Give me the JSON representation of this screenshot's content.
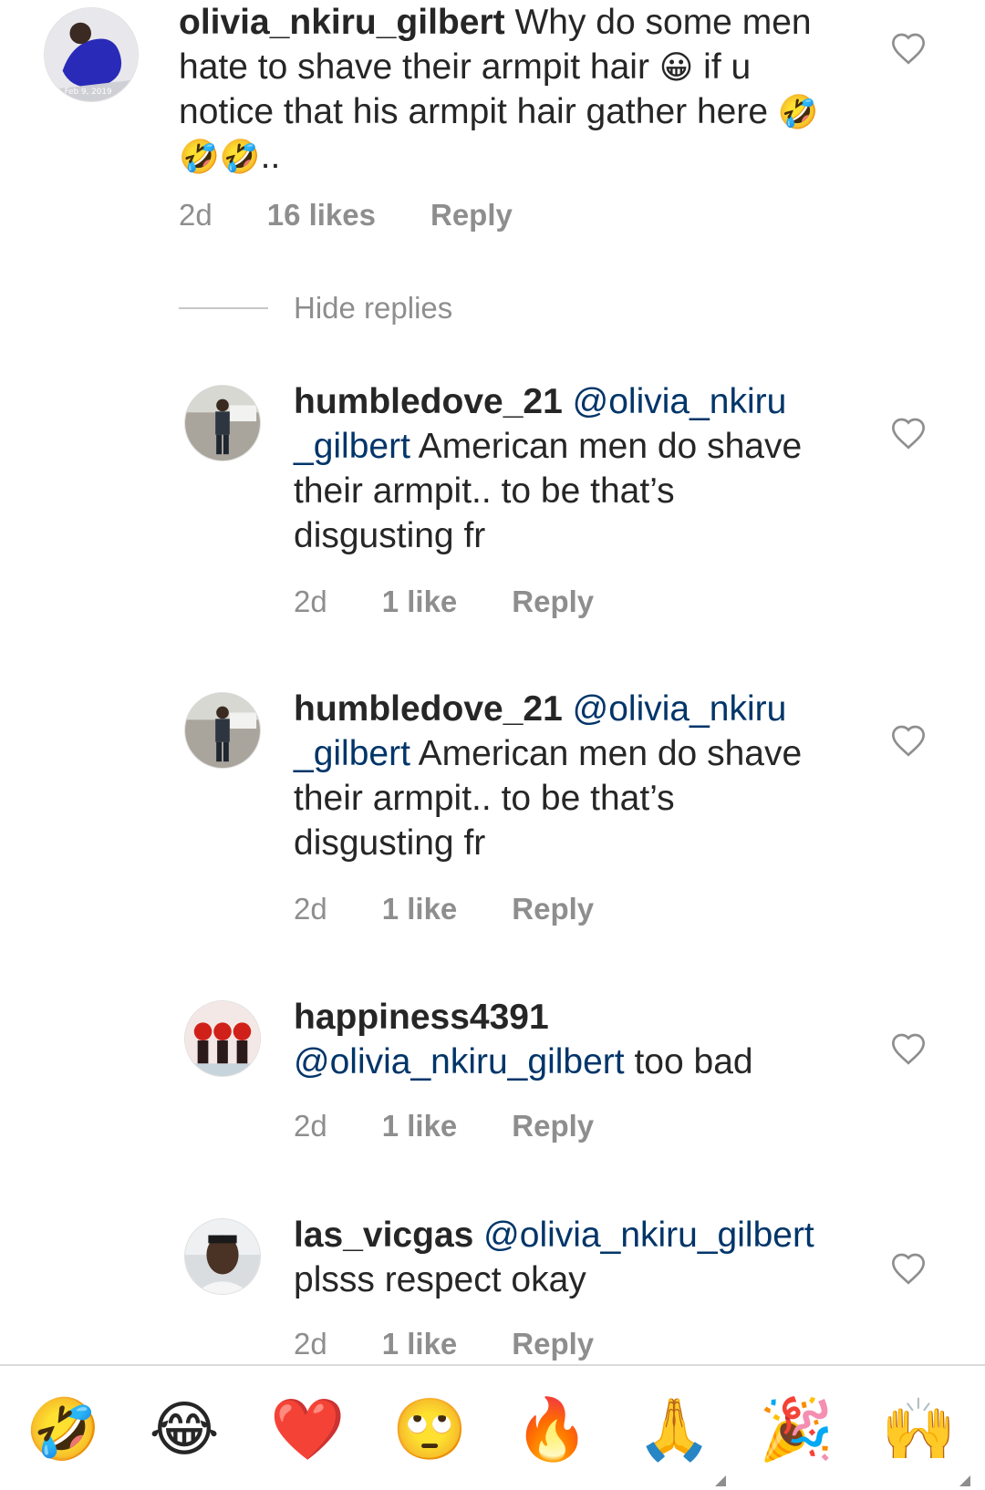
{
  "comments": [
    {
      "username": "olivia_nkiru_gilbert",
      "mention": "",
      "text": "Why do some men hate to shave their armpit hair",
      "emoji1": "😀",
      "text2": "if u notice that his armpit hair gather here",
      "emoji2": "🤣🤣🤣",
      "text3": "..",
      "avatar_caption": "Feb 9, 2019",
      "time": "2d",
      "likes": "16 likes",
      "reply": "Reply"
    },
    {
      "username": "humbledove_21",
      "mention": "@olivia_nkiru _gilbert",
      "text": "American men do shave their armpit.. to be that’s disgusting fr",
      "time": "2d",
      "likes": "1 like",
      "reply": "Reply"
    },
    {
      "username": "humbledove_21",
      "mention": "@olivia_nkiru _gilbert",
      "text": "American men do shave their armpit.. to be that’s disgusting fr",
      "time": "2d",
      "likes": "1 like",
      "reply": "Reply"
    },
    {
      "username": "happiness4391",
      "mention": "@olivia_nkiru_gilbert",
      "text": "too bad",
      "time": "2d",
      "likes": "1 like",
      "reply": "Reply"
    },
    {
      "username": "las_vicgas",
      "mention": "@olivia_nkiru_gilbert",
      "text": "plsss respect okay",
      "time": "2d",
      "likes": "1 like",
      "reply": "Reply"
    }
  ],
  "hide_replies_label": "Hide replies",
  "emoji_bar": [
    "🤣",
    "😂",
    "❤️",
    "🙄",
    "🔥",
    "🙏",
    "🎉",
    "🙌"
  ],
  "colors": {
    "text": "#262626",
    "mention": "#003569",
    "meta": "#8e8e8e",
    "divider": "#dbdbdb"
  }
}
